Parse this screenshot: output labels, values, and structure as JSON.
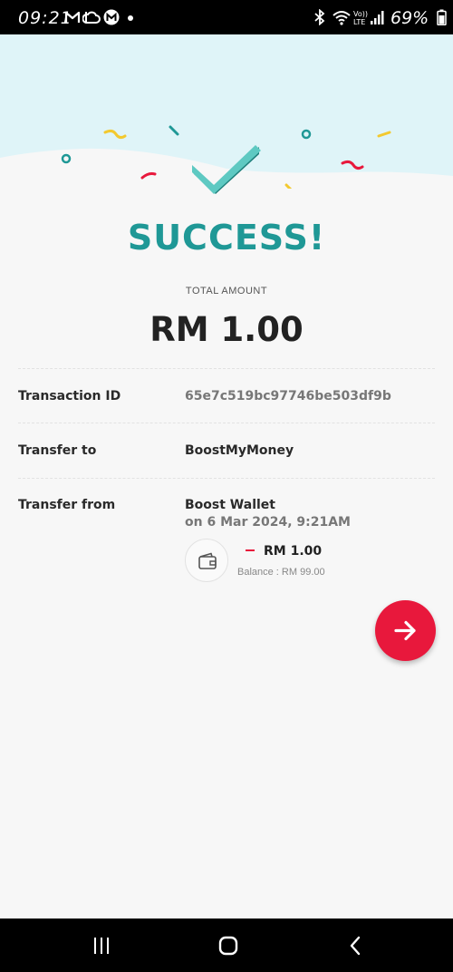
{
  "status_bar": {
    "time": "09:21",
    "battery_percent": "69%",
    "left_icons": [
      "gmail-icon",
      "cloud-icon",
      "maxis-icon"
    ],
    "right_icons": [
      "bluetooth-icon",
      "wifi-icon",
      "volte-icon",
      "signal-icon",
      "battery-icon"
    ]
  },
  "result": {
    "title": "SUCCESS!",
    "total_label": "TOTAL AMOUNT",
    "total_amount": "RM 1.00"
  },
  "details": {
    "transaction_id_label": "Transaction ID",
    "transaction_id_value": "65e7c519bc97746be503df9b",
    "transfer_to_label": "Transfer to",
    "transfer_to_value": "BoostMyMoney",
    "transfer_from_label": "Transfer from",
    "transfer_from_value": "Boost Wallet",
    "transfer_from_date": "on 6 Mar 2024, 9:21AM"
  },
  "wallet": {
    "icon": "wallet-icon",
    "amount": "RM 1.00",
    "balance": "Balance : RM 99.00"
  },
  "colors": {
    "accent_teal": "#1f9896",
    "accent_red": "#e8183c",
    "hero_bg": "#dff4f8"
  },
  "nav_bar": {
    "items": [
      "recent-apps",
      "home",
      "back"
    ]
  }
}
